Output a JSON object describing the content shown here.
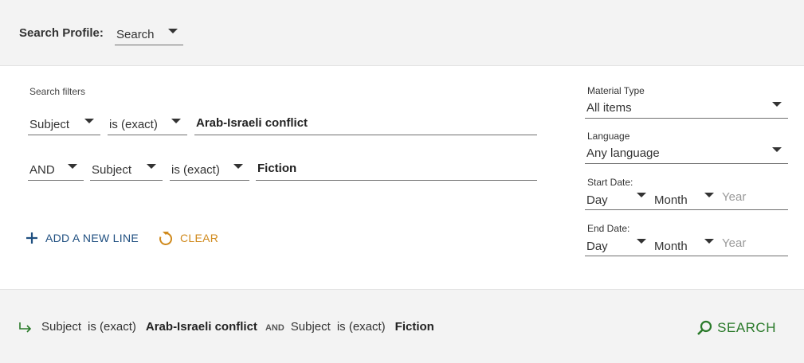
{
  "profile": {
    "label": "Search Profile:",
    "value": "Search"
  },
  "filters": {
    "title": "Search filters",
    "line1": {
      "field": "Subject",
      "operator": "is (exact)",
      "value": "Arab-Israeli conflict"
    },
    "line2": {
      "boolean": "AND",
      "field": "Subject",
      "operator": "is (exact)",
      "value": "Fiction"
    },
    "add_line": "ADD A NEW LINE",
    "clear": "CLEAR"
  },
  "side": {
    "material_type": {
      "label": "Material Type",
      "value": "All items"
    },
    "language": {
      "label": "Language",
      "value": "Any language"
    },
    "start_date": {
      "label": "Start Date:",
      "day": "Day",
      "month": "Month",
      "year_placeholder": "Year"
    },
    "end_date": {
      "label": "End Date:",
      "day": "Day",
      "month": "Month",
      "year_placeholder": "Year"
    }
  },
  "summary": {
    "field1": "Subject",
    "op1": "is (exact)",
    "value1": "Arab-Israeli conflict",
    "bool": "AND",
    "field2": "Subject",
    "op2": "is (exact)",
    "value2": "Fiction"
  },
  "search_button": "SEARCH",
  "colors": {
    "accent_blue": "#1f4f80",
    "clear_orange": "#d08a1d",
    "search_green": "#2a7a2a",
    "bar_gray": "#f3f3f3"
  },
  "icons": [
    "plus-icon",
    "refresh-icon",
    "arrow-return-icon",
    "magnifier-icon",
    "chevron-down-icon"
  ]
}
